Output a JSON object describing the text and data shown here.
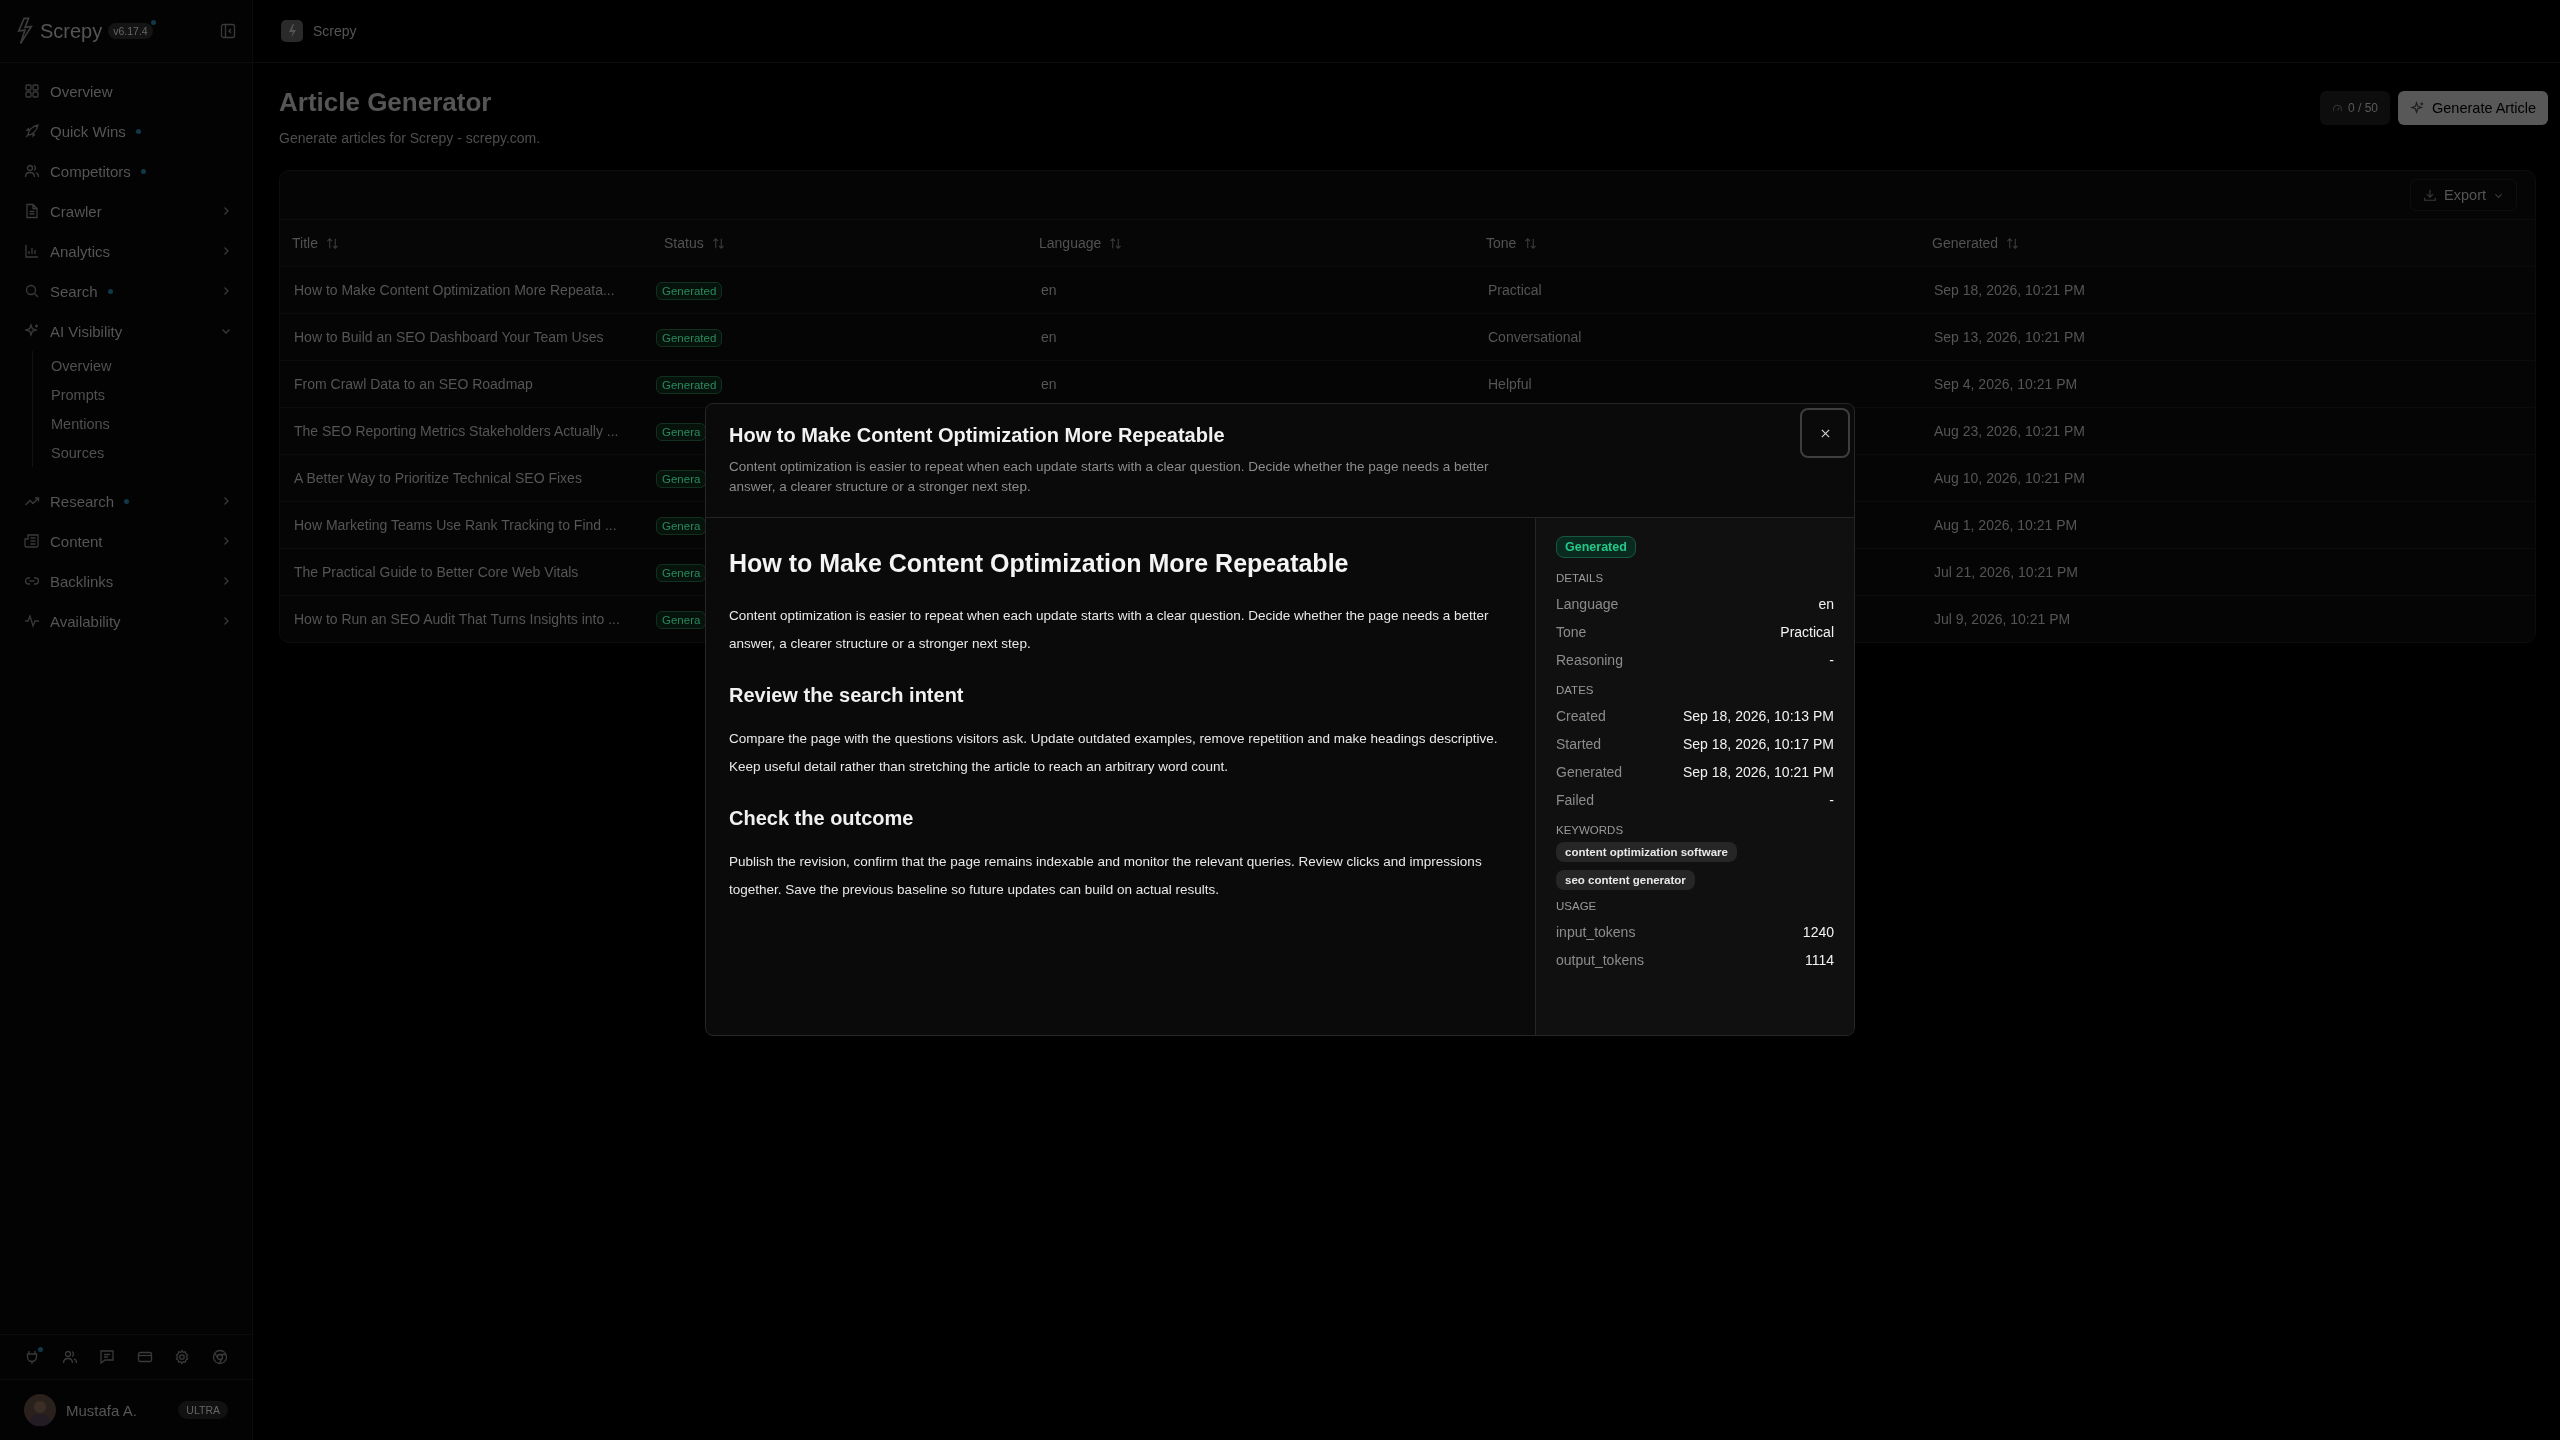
{
  "sidebar": {
    "logo": "Screpy",
    "version": "v6.17.4",
    "update_available": true,
    "nav": [
      {
        "label": "Overview",
        "new": false,
        "expandable": false
      },
      {
        "label": "Quick Wins",
        "new": true,
        "expandable": false
      },
      {
        "label": "Competitors",
        "new": true,
        "expandable": false
      },
      {
        "label": "Crawler",
        "new": false,
        "expandable": true,
        "expanded": false
      },
      {
        "label": "Analytics",
        "new": false,
        "expandable": true,
        "expanded": false
      },
      {
        "label": "Search",
        "new": true,
        "expandable": true,
        "expanded": false
      },
      {
        "label": "AI Visibility",
        "new": false,
        "expandable": true,
        "expanded": true,
        "children": [
          {
            "label": "Overview"
          },
          {
            "label": "Prompts"
          },
          {
            "label": "Mentions"
          },
          {
            "label": "Sources"
          }
        ]
      },
      {
        "label": "Research",
        "new": true,
        "expandable": true,
        "expanded": false
      },
      {
        "label": "Content",
        "new": false,
        "expandable": true,
        "expanded": false
      },
      {
        "label": "Backlinks",
        "new": false,
        "expandable": true,
        "expanded": false
      },
      {
        "label": "Availability",
        "new": false,
        "expandable": true,
        "expanded": false
      }
    ],
    "integrations_alert": true,
    "user": {
      "name": "Mustafa A.",
      "plan": "ULTRA"
    }
  },
  "topbar": {
    "breadcrumb": "Screpy"
  },
  "page": {
    "title": "Article Generator",
    "subtitle": "Generate articles for Screpy - screpy.com.",
    "quota": "0 / 50",
    "primary_button": "Generate Article",
    "export_button": "Export"
  },
  "table": {
    "columns": [
      "Title",
      "Status",
      "Language",
      "Tone",
      "Generated"
    ],
    "rows": [
      {
        "title": "How to Make Content Optimization More Repeata...",
        "status": "Generated",
        "language": "en",
        "tone": "Practical",
        "generated": "Sep 18, 2026, 10:21 PM"
      },
      {
        "title": "How to Build an SEO Dashboard Your Team Uses",
        "status": "Generated",
        "language": "en",
        "tone": "Conversational",
        "generated": "Sep 13, 2026, 10:21 PM"
      },
      {
        "title": "From Crawl Data to an SEO Roadmap",
        "status": "Generated",
        "language": "en",
        "tone": "Helpful",
        "generated": "Sep 4, 2026, 10:21 PM"
      },
      {
        "title": "The SEO Reporting Metrics Stakeholders Actually ...",
        "status": "Genera",
        "generated": "Aug 23, 2026, 10:21 PM"
      },
      {
        "title": "A Better Way to Prioritize Technical SEO Fixes",
        "status": "Genera",
        "generated": "Aug 10, 2026, 10:21 PM"
      },
      {
        "title": "How Marketing Teams Use Rank Tracking to Find ...",
        "status": "Genera",
        "generated": "Aug 1, 2026, 10:21 PM"
      },
      {
        "title": "The Practical Guide to Better Core Web Vitals",
        "status": "Genera",
        "generated": "Jul 21, 2026, 10:21 PM"
      },
      {
        "title": "How to Run an SEO Audit That Turns Insights into ...",
        "status": "Genera",
        "generated": "Jul 9, 2026, 10:21 PM"
      }
    ]
  },
  "modal": {
    "title": "How to Make Content Optimization More Repeatable",
    "summary": "Content optimization is easier to repeat when each update starts with a clear question. Decide whether the page needs a better answer, a clearer structure or a stronger next step.",
    "article": [
      {
        "kind": "h1",
        "text": "How to Make Content Optimization More Repeatable"
      },
      {
        "kind": "p",
        "text": "Content optimization is easier to repeat when each update starts with a clear question. Decide whether the page needs a better answer, a clearer structure or a stronger next step."
      },
      {
        "kind": "h2",
        "text": "Review the search intent"
      },
      {
        "kind": "p",
        "text": "Compare the page with the questions visitors ask. Update outdated examples, remove repetition and make headings descriptive. Keep useful detail rather than stretching the article to reach an arbitrary word count."
      },
      {
        "kind": "h2",
        "text": "Check the outcome"
      },
      {
        "kind": "p",
        "text": "Publish the revision, confirm that the page remains indexable and monitor the relevant queries. Review clicks and impressions together. Save the previous baseline so future updates can build on actual results."
      }
    ],
    "status": "Generated",
    "sections": [
      {
        "kind": "fields",
        "heading": "DETAILS",
        "fields": [
          {
            "label": "Language",
            "value": "en"
          },
          {
            "label": "Tone",
            "value": "Practical"
          },
          {
            "label": "Reasoning",
            "value": "-"
          }
        ]
      },
      {
        "kind": "fields",
        "heading": "DATES",
        "fields": [
          {
            "label": "Created",
            "value": "Sep 18, 2026, 10:13 PM"
          },
          {
            "label": "Started",
            "value": "Sep 18, 2026, 10:17 PM"
          },
          {
            "label": "Generated",
            "value": "Sep 18, 2026, 10:21 PM"
          },
          {
            "label": "Failed",
            "value": "-"
          }
        ]
      },
      {
        "kind": "tags",
        "heading": "KEYWORDS",
        "tags": [
          "content optimization software",
          "seo content generator"
        ]
      },
      {
        "kind": "fields",
        "heading": "USAGE",
        "fields": [
          {
            "label": "input_tokens",
            "value": "1240"
          },
          {
            "label": "output_tokens",
            "value": "1114"
          }
        ]
      }
    ]
  }
}
